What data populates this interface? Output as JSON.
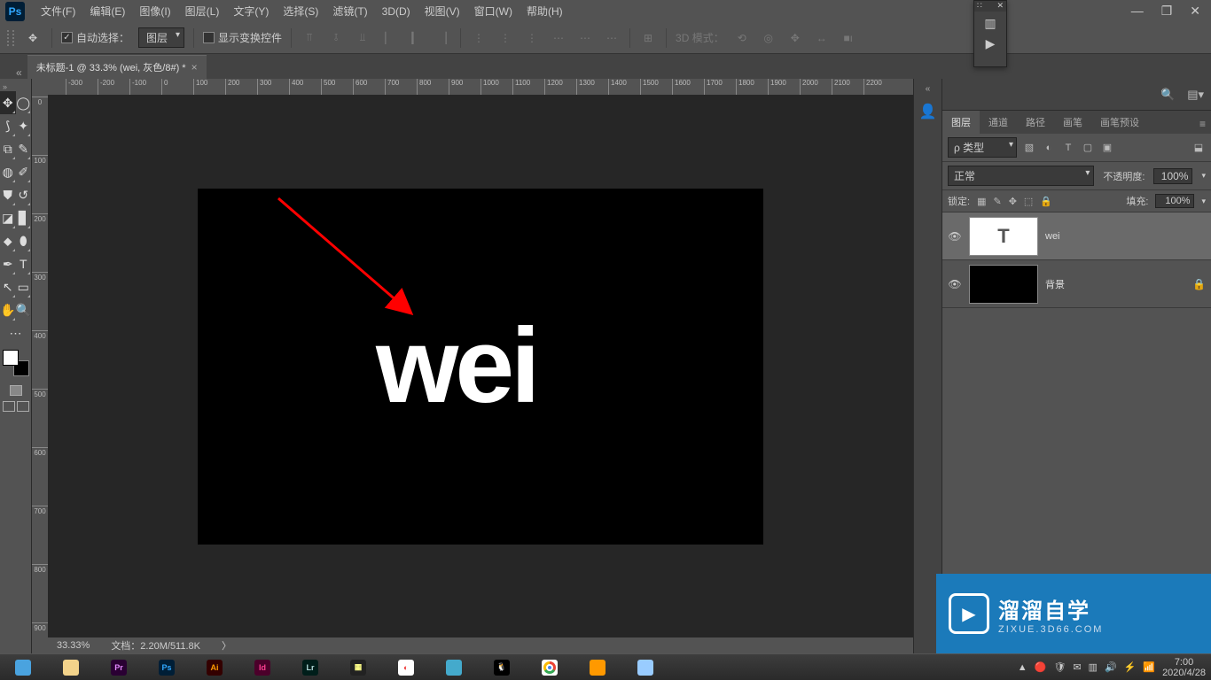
{
  "app": {
    "logo": "Ps"
  },
  "menu": [
    "文件(F)",
    "编辑(E)",
    "图像(I)",
    "图层(L)",
    "文字(Y)",
    "选择(S)",
    "滤镜(T)",
    "3D(D)",
    "视图(V)",
    "窗口(W)",
    "帮助(H)"
  ],
  "window_controls": {
    "min": "—",
    "max": "❐",
    "close": "✕"
  },
  "options": {
    "auto_select_checked": true,
    "auto_select_label": "自动选择：",
    "target": "图层",
    "show_transform_checked": false,
    "show_transform_label": "显示变换控件",
    "mode3d_label": "3D 模式："
  },
  "doc_tab": "未标题-1 @ 33.3% (wei, 灰色/8#) *",
  "ruler_h": [
    "-300",
    "-200",
    "-100",
    "0",
    "100",
    "200",
    "300",
    "400",
    "500",
    "600",
    "700",
    "800",
    "900",
    "1000",
    "1100",
    "1200",
    "1300",
    "1400",
    "1500",
    "1600",
    "1700",
    "1800",
    "1900",
    "2000",
    "2100",
    "2200"
  ],
  "ruler_v": [
    "0",
    "100",
    "200",
    "300",
    "400",
    "500",
    "600",
    "700",
    "800",
    "900"
  ],
  "canvas_text": "wei",
  "status": {
    "zoom": "33.33%",
    "doc": "文档：2.20M/511.8K"
  },
  "panels": {
    "tabs": [
      "图层",
      "通道",
      "路径",
      "画笔",
      "画笔预设"
    ],
    "filter_type": "ρ 类型",
    "blend_mode": "正常",
    "opacity_label": "不透明度:",
    "opacity_value": "100%",
    "lock_label": "锁定:",
    "fill_label": "填充:",
    "fill_value": "100%",
    "layers": [
      {
        "name": "wei",
        "thumb": "T",
        "selected": true,
        "locked": false
      },
      {
        "name": "背景",
        "thumb": "",
        "selected": false,
        "locked": true
      }
    ]
  },
  "watermark": {
    "cn": "溜溜自学",
    "en": "ZIXUE.3D66.COM"
  },
  "taskbar": {
    "apps": [
      {
        "bg": "#4aa3df",
        "txt": "",
        "fg": "#fff"
      },
      {
        "bg": "#f3d38b",
        "txt": "",
        "fg": "#333"
      },
      {
        "bg": "#2a0033",
        "txt": "Pr",
        "fg": "#e389ff"
      },
      {
        "bg": "#001e36",
        "txt": "Ps",
        "fg": "#31a8ff"
      },
      {
        "bg": "#330000",
        "txt": "Ai",
        "fg": "#ff9a00"
      },
      {
        "bg": "#4b002a",
        "txt": "Id",
        "fg": "#ff3f92"
      },
      {
        "bg": "#001e1a",
        "txt": "Lr",
        "fg": "#b4dcdc"
      },
      {
        "bg": "#222",
        "txt": "▦",
        "fg": "#ff8"
      },
      {
        "bg": "#fff",
        "txt": "◐",
        "fg": "#e33"
      },
      {
        "bg": "#4ac",
        "txt": "",
        "fg": "#fff"
      },
      {
        "bg": "#000",
        "txt": "🐧",
        "fg": "#fff"
      },
      {
        "bg": "#fff",
        "txt": "",
        "fg": "#333",
        "chrome": true
      },
      {
        "bg": "#f90",
        "txt": "",
        "fg": "#fff"
      },
      {
        "bg": "#9cf",
        "txt": "",
        "fg": "#fff"
      }
    ],
    "time": "7:00",
    "date": "2020/4/28"
  }
}
